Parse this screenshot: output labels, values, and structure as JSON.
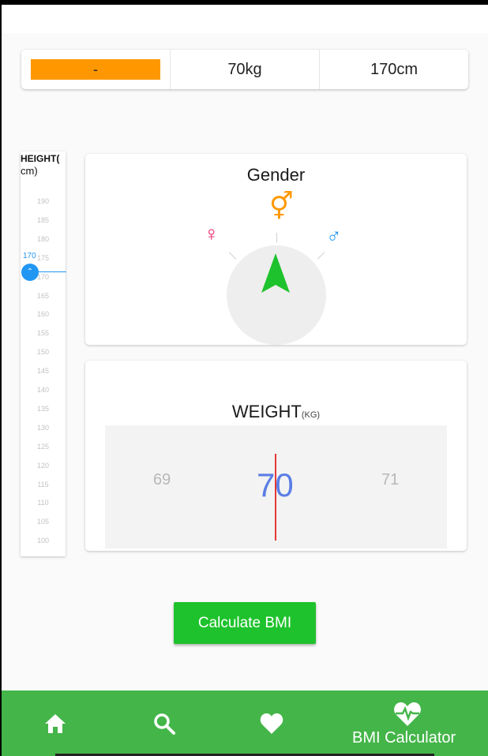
{
  "summary": {
    "bmi_value": "-",
    "weight": "70kg",
    "height": "170cm"
  },
  "height_slider": {
    "label": "HEIGHT(",
    "unit": "cm)",
    "current_value": "170",
    "ticks": [
      "190",
      "185",
      "180",
      "175",
      "170",
      "165",
      "160",
      "155",
      "150",
      "145",
      "140",
      "135",
      "130",
      "125",
      "120",
      "115",
      "110",
      "105",
      "100"
    ]
  },
  "gender": {
    "title": "Gender",
    "options": [
      {
        "name": "female",
        "symbol": "♀"
      },
      {
        "name": "other",
        "symbol": "⚥"
      },
      {
        "name": "male",
        "symbol": "♂"
      }
    ]
  },
  "weight": {
    "title": "WEIGHT",
    "unit": "(KG)",
    "prev": "69",
    "current": "70",
    "next": "71"
  },
  "calculate_button": "Calculate BMI",
  "bottom_nav": {
    "items": [
      {
        "icon": "home-icon"
      },
      {
        "icon": "search-icon"
      },
      {
        "icon": "heart-icon"
      },
      {
        "icon": "heartbeat-icon",
        "label": "BMI Calculator"
      }
    ]
  },
  "colors": {
    "accent_orange": "#ff9800",
    "accent_blue": "#2196f3",
    "nav_green": "#44b549",
    "button_green": "#1ec22c",
    "pointer_green": "#1ec22c",
    "female_pink": "#e91e63",
    "weight_blue": "#5b7ee5",
    "indicator_red": "#e53935"
  }
}
